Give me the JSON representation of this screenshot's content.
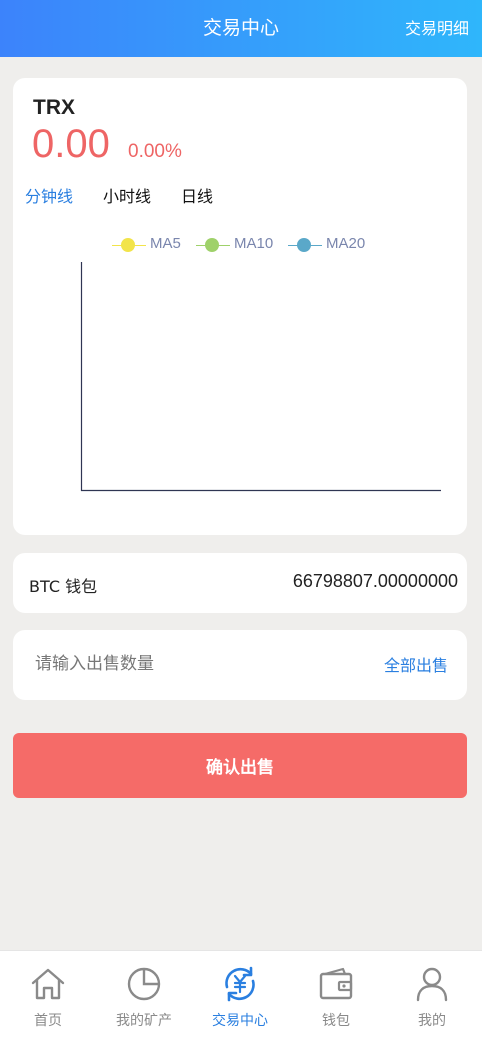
{
  "header": {
    "title": "交易中心",
    "detail_link": "交易明细"
  },
  "market": {
    "symbol": "TRX",
    "price": "0.00",
    "change": "0.00%",
    "tabs": [
      {
        "label": "分钟线",
        "active": true
      },
      {
        "label": "小时线",
        "active": false
      },
      {
        "label": "日线",
        "active": false
      }
    ]
  },
  "chart_data": {
    "type": "line",
    "series": [
      {
        "name": "MA5",
        "color": "#f2e44a",
        "values": []
      },
      {
        "name": "MA10",
        "color": "#9fd16a",
        "values": []
      },
      {
        "name": "MA20",
        "color": "#5aa8c9",
        "values": []
      }
    ],
    "legend": "top-center",
    "grid": false
  },
  "wallet": {
    "label": "BTC 钱包",
    "balance": "66798807.00000000"
  },
  "sell": {
    "placeholder": "请输入出售数量",
    "sell_all": "全部出售"
  },
  "confirm_button": "确认出售",
  "colors": {
    "accent": "#2a7fe0",
    "price_red": "#ee6565",
    "button_red": "#f56b68"
  },
  "nav": [
    {
      "label": "首页",
      "icon": "home-icon",
      "active": false
    },
    {
      "label": "我的矿产",
      "icon": "pie-chart-icon",
      "active": false
    },
    {
      "label": "交易中心",
      "icon": "yuan-exchange-icon",
      "active": true
    },
    {
      "label": "钱包",
      "icon": "wallet-icon",
      "active": false
    },
    {
      "label": "我的",
      "icon": "user-icon",
      "active": false
    }
  ]
}
